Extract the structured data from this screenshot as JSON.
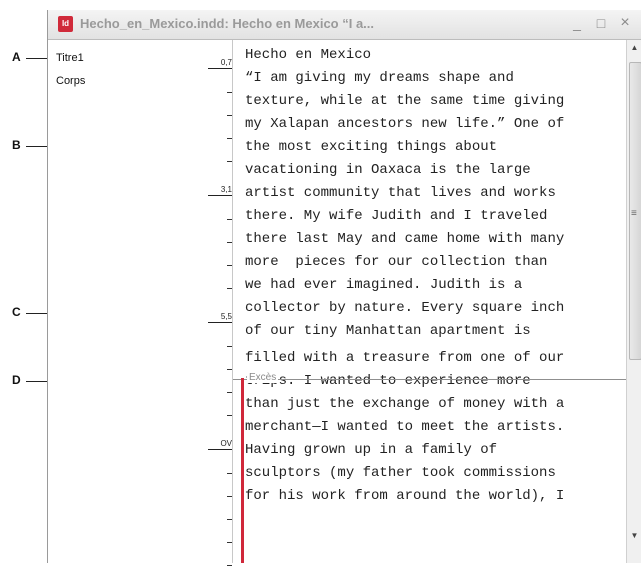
{
  "callouts": [
    {
      "label": "A"
    },
    {
      "label": "B"
    },
    {
      "label": "C"
    },
    {
      "label": "D"
    }
  ],
  "window": {
    "title": "Hecho_en_Mexico.indd: Hecho en Mexico “I a...",
    "app_icon_text": "Id",
    "controls": {
      "minimize": "_",
      "maximize": "□",
      "close": "×"
    }
  },
  "styles_panel": {
    "items": [
      "Titre1",
      "Corps"
    ],
    "ruler_marks": [
      "0,7",
      "3,1",
      "5,5",
      "OV"
    ]
  },
  "story_editor": {
    "lines": [
      "Hecho en Mexico",
      "“I am giving my dreams shape and",
      "texture, while at the same time giving",
      "my Xalapan ancestors new life.” One of",
      "the most exciting things about",
      "vacationing in Oaxaca is the large",
      "artist community that lives and works",
      "there. My wife Judith and I traveled",
      "there last May and came home with many",
      "more  pieces for our collection than",
      "we had ever imagined. Judith is a",
      "collector by nature. Every square inch",
      "of our tiny Manhattan apartment is",
      "filled with a treasure from one of our",
      "trips. I wanted to experience more",
      "than just the exchange of money with a",
      "merchant—I wanted to meet the artists.",
      "Having grown up in a family of",
      "sculptors (my father took commissions",
      "for his work from around the world), I"
    ],
    "overset_label": "Excès"
  },
  "scrollbar": {
    "up": "▲",
    "down": "▼",
    "grip": "≡"
  }
}
